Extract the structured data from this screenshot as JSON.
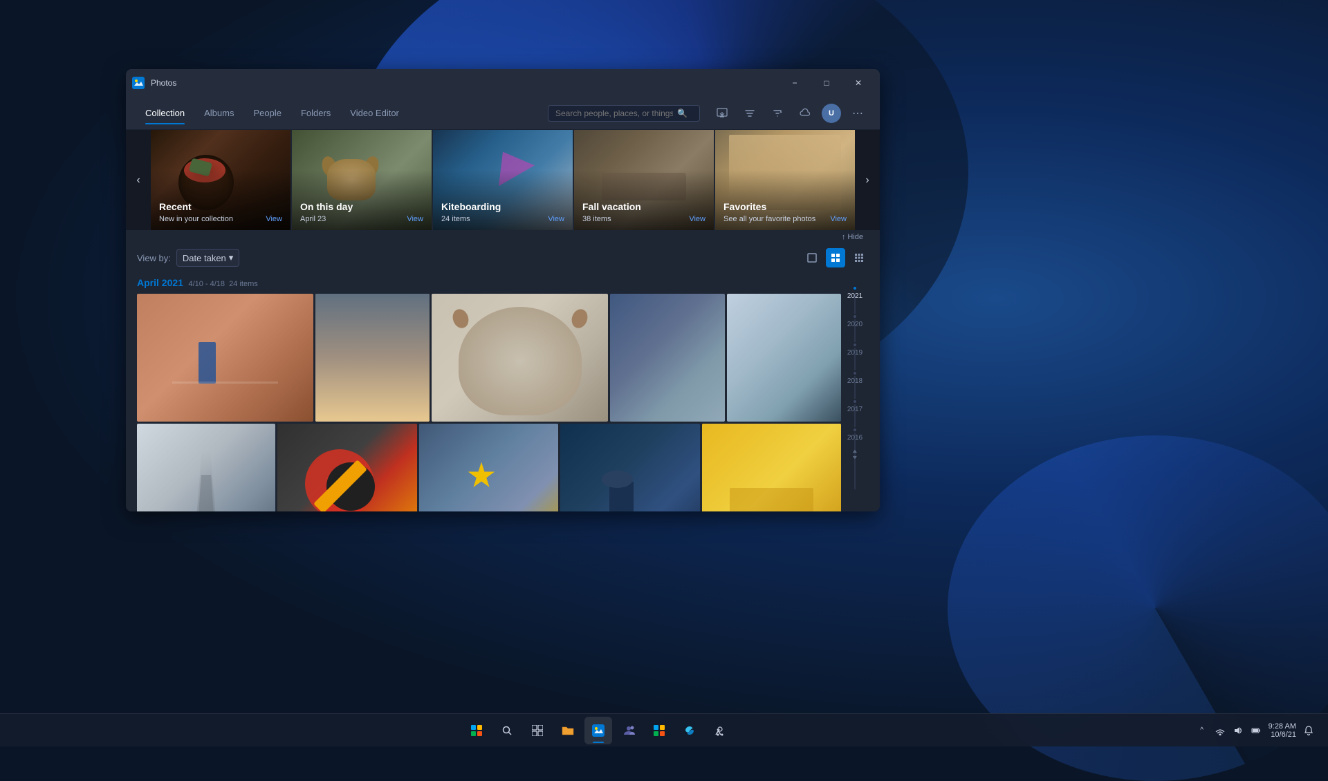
{
  "app": {
    "title": "Photos",
    "icon": "photos-icon"
  },
  "titlebar": {
    "minimize_label": "−",
    "maximize_label": "□",
    "close_label": "✕"
  },
  "nav": {
    "items": [
      {
        "label": "Collection",
        "active": true,
        "id": "collection"
      },
      {
        "label": "Albums",
        "active": false,
        "id": "albums"
      },
      {
        "label": "People",
        "active": false,
        "id": "people"
      },
      {
        "label": "Folders",
        "active": false,
        "id": "folders"
      },
      {
        "label": "Video Editor",
        "active": false,
        "id": "video-editor"
      }
    ],
    "search_placeholder": "Search people, places, or things..."
  },
  "highlights": {
    "nav_prev": "‹",
    "nav_next": "›",
    "cards": [
      {
        "id": "recent",
        "title": "Recent",
        "subtitle": "New in your collection",
        "view_label": "View",
        "bg_class": "bg-food"
      },
      {
        "id": "on-this-day",
        "title": "On this day",
        "subtitle": "April 23",
        "view_label": "View",
        "bg_class": "bg-dog"
      },
      {
        "id": "kiteboarding",
        "title": "Kiteboarding",
        "subtitle": "24 items",
        "view_label": "View",
        "bg_class": "bg-kite"
      },
      {
        "id": "fall-vacation",
        "title": "Fall vacation",
        "subtitle": "38 items",
        "view_label": "View",
        "bg_class": "bg-rocks"
      },
      {
        "id": "favorites",
        "title": "Favorites",
        "subtitle": "See all your favorite photos",
        "view_label": "View",
        "bg_class": "bg-arch"
      }
    ]
  },
  "view_by": {
    "label": "View by:",
    "current": "Date taken",
    "dropdown_arrow": "▾",
    "hide_label": "↑ Hide"
  },
  "view_modes": [
    {
      "id": "single",
      "icon": "□",
      "label": "Single view"
    },
    {
      "id": "grid-medium",
      "icon": "⊞",
      "label": "Medium grid",
      "active": true
    },
    {
      "id": "grid-small",
      "icon": "⊟",
      "label": "Small grid"
    }
  ],
  "month_group": {
    "title": "April 2021",
    "range": "4/10 - 4/18",
    "count": "24 items"
  },
  "photos": {
    "row1": [
      {
        "id": "desert",
        "bg_class": "photo-desert",
        "width": "255"
      },
      {
        "id": "paris-city",
        "bg_class": "photo-paris",
        "width": "130"
      },
      {
        "id": "dog2",
        "bg_class": "photo-dog2",
        "width": "255"
      },
      {
        "id": "shore",
        "bg_class": "photo-shore",
        "width": "180"
      },
      {
        "id": "coast",
        "bg_class": "photo-coast",
        "width": "145"
      }
    ],
    "row2": [
      {
        "id": "eiffel",
        "bg_class": "photo-eiffel",
        "width": "200"
      },
      {
        "id": "tools",
        "bg_class": "photo-tools",
        "width": "290"
      },
      {
        "id": "star-kite",
        "bg_class": "photo-star",
        "width": "175"
      },
      {
        "id": "bird",
        "bg_class": "photo-bird",
        "width": "175"
      },
      {
        "id": "yellow-house",
        "bg_class": "photo-yellow",
        "width": "130"
      }
    ]
  },
  "timeline": {
    "years": [
      {
        "year": "2021",
        "active": true
      },
      {
        "year": "2020",
        "active": false
      },
      {
        "year": "2019",
        "active": false
      },
      {
        "year": "2018",
        "active": false
      },
      {
        "year": "2017",
        "active": false
      },
      {
        "year": "2016",
        "active": false
      }
    ]
  },
  "taskbar": {
    "icons": [
      {
        "id": "start",
        "icon": "⊞",
        "label": "Start"
      },
      {
        "id": "search",
        "icon": "🔍",
        "label": "Search"
      },
      {
        "id": "explorer",
        "icon": "📁",
        "label": "File Explorer"
      },
      {
        "id": "photos-app",
        "icon": "🖼",
        "label": "Photos",
        "active": true
      },
      {
        "id": "teams",
        "icon": "👥",
        "label": "Teams"
      },
      {
        "id": "files",
        "icon": "📂",
        "label": "Files"
      },
      {
        "id": "edge",
        "icon": "🌐",
        "label": "Edge"
      },
      {
        "id": "store",
        "icon": "🛍",
        "label": "Store"
      }
    ],
    "time": "9:28 AM",
    "date": "10/6/21"
  }
}
